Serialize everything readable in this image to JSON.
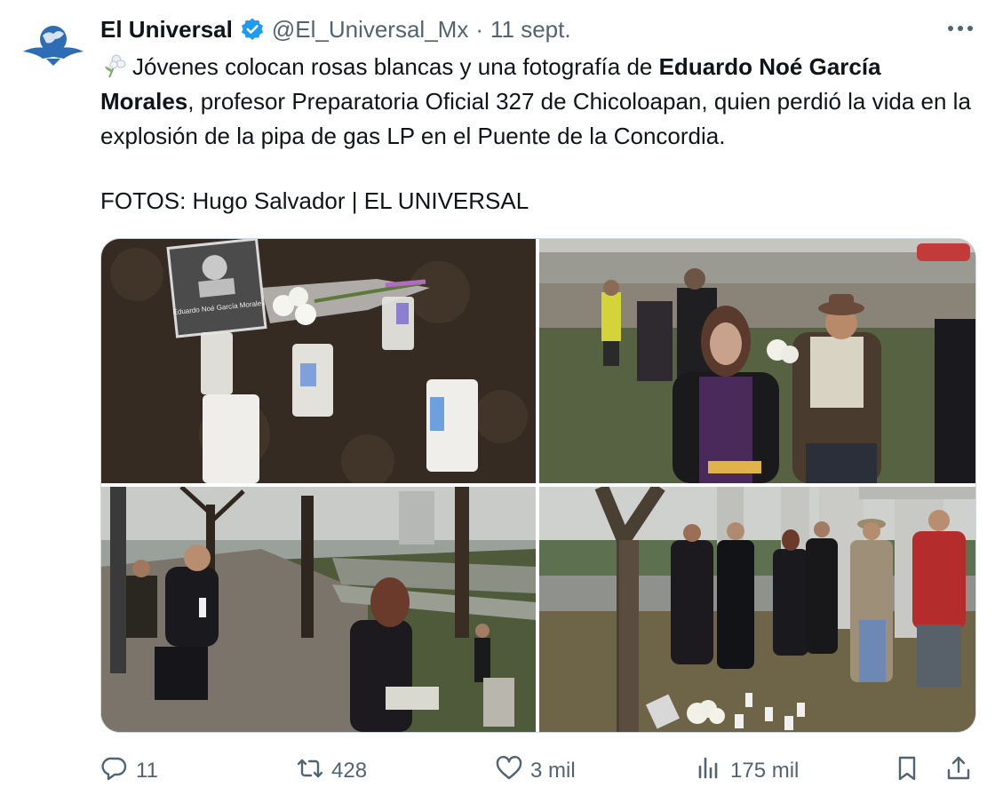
{
  "author": {
    "name": "El Universal",
    "handle": "@El_Universal_Mx",
    "separator": "·",
    "date": "11 sept."
  },
  "icons": {
    "avatar": "el-universal-logo",
    "verified": "verified-badge-icon",
    "more": "more-icon",
    "emoji": "white-flower-emoji",
    "reply": "reply-icon",
    "retweet": "retweet-icon",
    "like": "heart-icon",
    "views": "views-chart-icon",
    "bookmark": "bookmark-icon",
    "share": "share-icon"
  },
  "tweet": {
    "text_part1": "Jóvenes colocan rosas blancas y una fotografía de ",
    "text_bold": "Eduardo Noé García Morales",
    "text_part2": ", profesor Preparatoria Oficial 327 de Chicoloapan, quien perdió la vida en la explosión de la pipa de gas LP en el Puente de la Concordia.",
    "credit": "FOTOS: Hugo Salvador | EL UNIVERSAL"
  },
  "photo_caption": {
    "name": "Eduardo Noé García Morales"
  },
  "stats": {
    "replies": "11",
    "retweets": "428",
    "likes": "3 mil",
    "views": "175 mil"
  },
  "colors": {
    "text": "#0f1419",
    "secondary": "#536471",
    "verified": "#1d9bf0",
    "border": "#cfd9de"
  }
}
